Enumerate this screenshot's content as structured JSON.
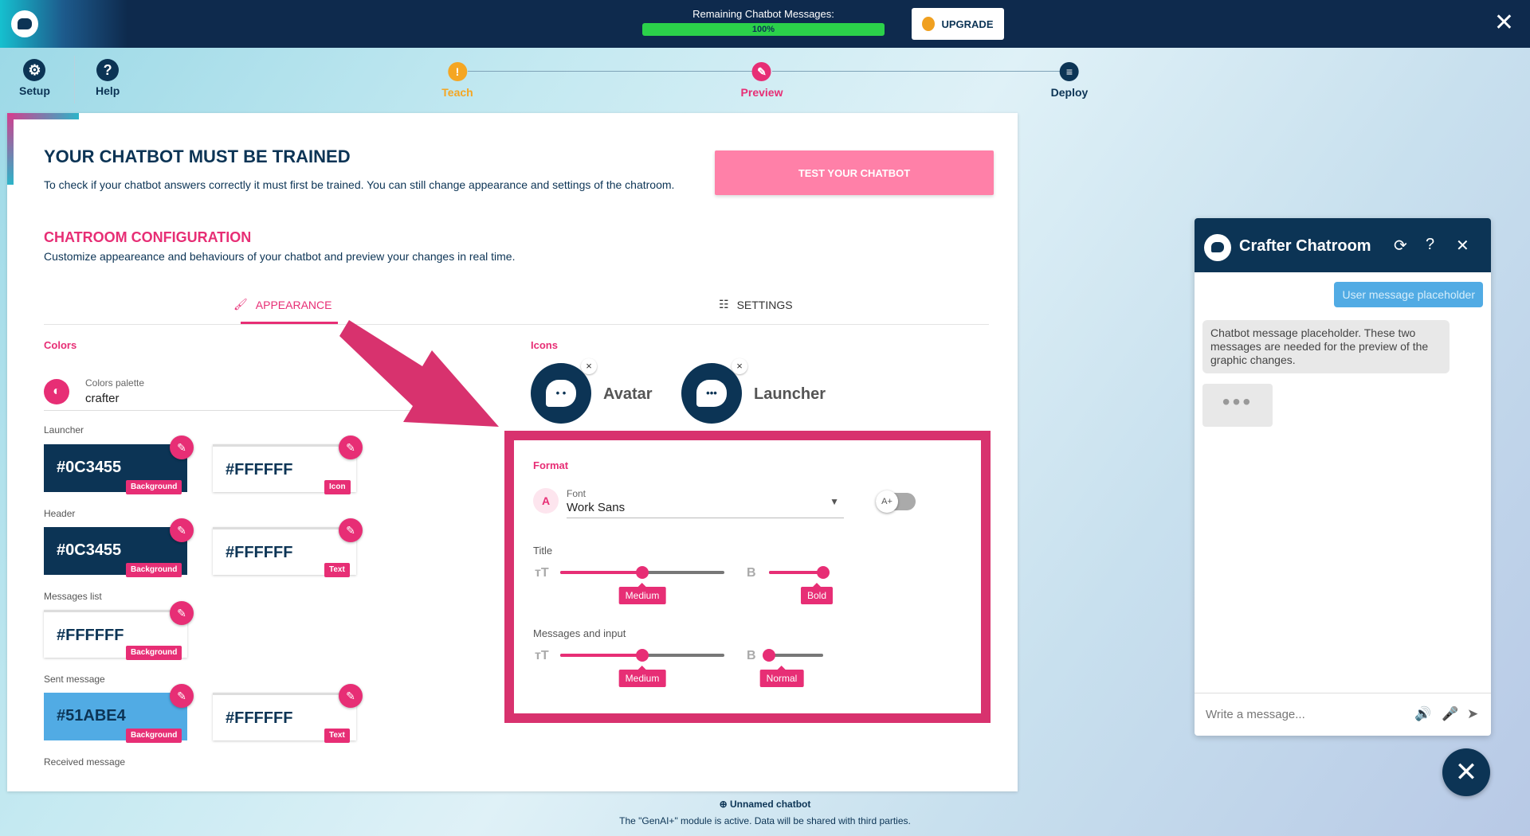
{
  "topbar": {
    "quota_label": "Remaining Chatbot Messages:",
    "quota_value": "100%",
    "quota_fraction": 1.0,
    "upgrade_label": "UPGRADE",
    "close_glyph": "✕"
  },
  "toolbar": {
    "setup_label": "Setup",
    "help_label": "Help"
  },
  "steps": [
    {
      "label": "Teach",
      "color": "#f5a623"
    },
    {
      "label": "Preview",
      "color": "#e72e75"
    },
    {
      "label": "Deploy",
      "color": "#0c3455"
    }
  ],
  "main": {
    "title": "YOUR CHATBOT MUST BE TRAINED",
    "description": "To check if your chatbot answers correctly it must first be trained. You can still change appearance and settings of the chatroom.",
    "test_button": "TEST YOUR CHATBOT",
    "config_title": "CHATROOM CONFIGURATION",
    "config_desc": "Customize appeareance and behaviours of your chatbot and preview your changes in real time.",
    "tabs": [
      {
        "label": "APPEARANCE"
      },
      {
        "label": "SETTINGS"
      }
    ]
  },
  "colors": {
    "section_label": "Colors",
    "palette_label": "Colors palette",
    "palette_value": "crafter",
    "groups": [
      {
        "label": "Launcher",
        "primary": "#0C3455",
        "primary_tag": "Background",
        "secondary": "#FFFFFF",
        "secondary_tag": "Icon"
      },
      {
        "label": "Header",
        "primary": "#0C3455",
        "primary_tag": "Background",
        "secondary": "#FFFFFF",
        "secondary_tag": "Text"
      },
      {
        "label": "Messages list",
        "primary": "#FFFFFF",
        "primary_tag": "Background"
      },
      {
        "label": "Sent message",
        "primary": "#51ABE4",
        "primary_tag": "Background",
        "secondary": "#FFFFFF",
        "secondary_tag": "Text"
      },
      {
        "label": "Received message"
      }
    ]
  },
  "icons": {
    "section_label": "Icons",
    "avatar_label": "Avatar",
    "launcher_label": "Launcher"
  },
  "format": {
    "section_label": "Format",
    "font_label": "Font",
    "font_value": "Work Sans",
    "toggle_label": "A+",
    "title_label": "Title",
    "title_size": "Medium",
    "title_weight": "Bold",
    "title_size_level": 0.5,
    "title_weight_level": 1.0,
    "messages_label": "Messages and input",
    "messages_size": "Medium",
    "messages_weight": "Normal",
    "messages_size_level": 0.5,
    "messages_weight_level": 0.0
  },
  "chatroom": {
    "title": "Crafter Chatroom",
    "user_message": "User message placeholder",
    "bot_message": "Chatbot message placeholder. These two messages are needed for the preview of the graphic changes.",
    "input_placeholder": "Write a message..."
  },
  "footer": {
    "bot_name": "Unnamed chatbot",
    "notice": "The \"GenAI+\" module is active. Data will be shared with third parties."
  }
}
